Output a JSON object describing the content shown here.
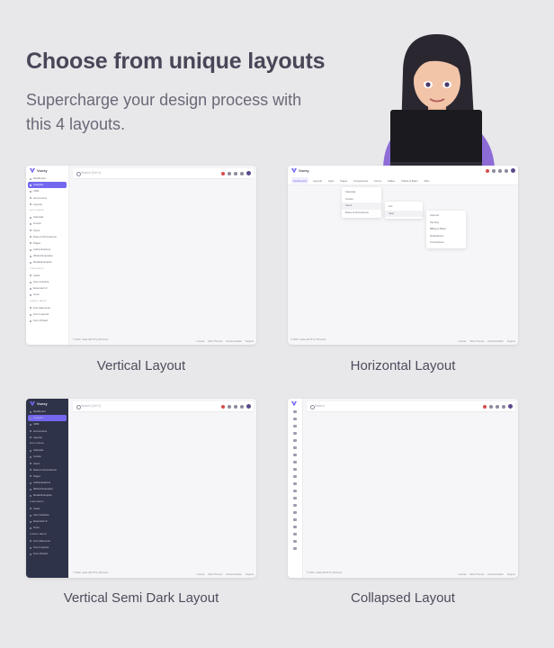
{
  "headline": "Choose from unique layouts",
  "subline": "Supercharge your design process with this 4 layouts.",
  "brand_color": "#7367f0",
  "layouts": [
    {
      "caption": "Vertical Layout"
    },
    {
      "caption": "Horizontal Layout"
    },
    {
      "caption": "Vertical Semi Dark Layout"
    },
    {
      "caption": "Collapsed Layout"
    }
  ],
  "app": {
    "brand": "Vuexy",
    "search_placeholder": "Search (Ctrl+/)",
    "search_placeholder_short": "Search",
    "footer_left": "© 2022, made with ❤ by Pixinvent",
    "footer_links": [
      "License",
      "More Themes",
      "Documentation",
      "Support"
    ]
  },
  "sidebar_items": [
    {
      "label": "Dashboard",
      "type": "item"
    },
    {
      "label": "Analytics",
      "type": "active"
    },
    {
      "label": "CRM",
      "type": "item"
    },
    {
      "label": "eCommerce",
      "type": "item"
    },
    {
      "label": "Layouts",
      "type": "item"
    },
    {
      "label": "APPS & PAGES",
      "type": "section"
    },
    {
      "label": "Calendar",
      "type": "item"
    },
    {
      "label": "Invoice",
      "type": "item"
    },
    {
      "label": "Users",
      "type": "item"
    },
    {
      "label": "Roles & Permissions",
      "type": "item"
    },
    {
      "label": "Pages",
      "type": "item"
    },
    {
      "label": "Authentications",
      "type": "item"
    },
    {
      "label": "Wizard Examples",
      "type": "item"
    },
    {
      "label": "Modal Examples",
      "type": "item"
    },
    {
      "label": "COMPONENTS",
      "type": "section"
    },
    {
      "label": "Cards",
      "type": "item"
    },
    {
      "label": "User Interface",
      "type": "item"
    },
    {
      "label": "Extended UI",
      "type": "item"
    },
    {
      "label": "Icons",
      "type": "item"
    },
    {
      "label": "FORMS & TABLES",
      "type": "section"
    },
    {
      "label": "Form Elements",
      "type": "item"
    },
    {
      "label": "Form Layouts",
      "type": "item"
    },
    {
      "label": "Form Wizard",
      "type": "item"
    }
  ],
  "horizontal_menu": [
    "Dashboards",
    "Layouts",
    "Apps",
    "Pages",
    "Components",
    "Forms",
    "Tables",
    "Charts & Maps",
    "Misc"
  ],
  "dropdown_apps": [
    "Calendar",
    "Invoice",
    "Users",
    "Roles & Permissions"
  ],
  "dropdown_users": [
    "List",
    "View"
  ],
  "dropdown_view": [
    "Account",
    "Security",
    "Billing & Plans",
    "Notifications",
    "Connections"
  ]
}
